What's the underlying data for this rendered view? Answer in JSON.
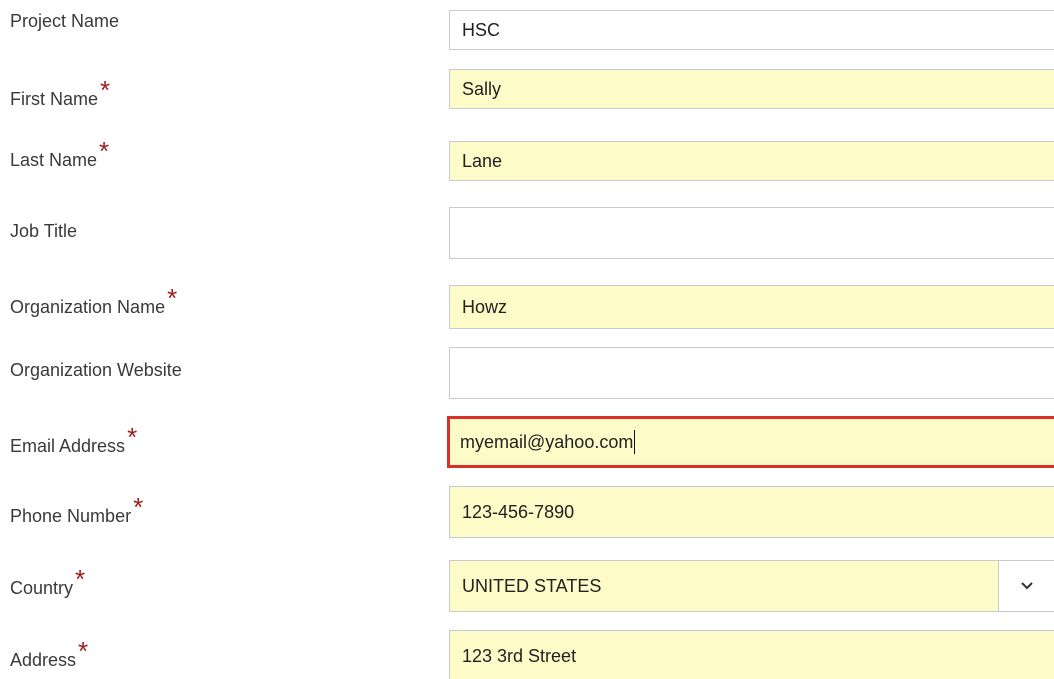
{
  "form": {
    "fields": [
      {
        "label": "Project Name",
        "required": false,
        "value": "HSC"
      },
      {
        "label": "First Name",
        "required": true,
        "value": "Sally"
      },
      {
        "label": "Last Name",
        "required": true,
        "value": "Lane"
      },
      {
        "label": "Job Title",
        "required": false,
        "value": ""
      },
      {
        "label": "Organization Name",
        "required": true,
        "value": "Howz"
      },
      {
        "label": "Organization Website",
        "required": false,
        "value": ""
      },
      {
        "label": "Email Address",
        "required": true,
        "value": "myemail@yahoo.com"
      },
      {
        "label": "Phone Number",
        "required": true,
        "value": "123-456-7890"
      },
      {
        "label": "Country",
        "required": true,
        "value": "UNITED STATES"
      },
      {
        "label": "Address",
        "required": true,
        "value": "123 3rd Street"
      }
    ],
    "required_marker": "*"
  },
  "colors": {
    "required_star": "#9b1c1c",
    "filled_bg": "#fdfbc8",
    "error_border": "#d9312a",
    "input_border": "#c7cbd1"
  },
  "icons": {
    "country_dropdown": "chevron-down-icon"
  }
}
